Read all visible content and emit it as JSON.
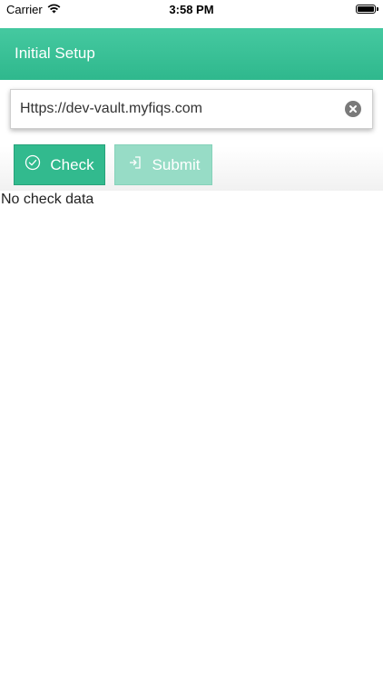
{
  "status_bar": {
    "carrier": "Carrier",
    "time": "3:58 PM",
    "icons": [
      "wifi-icon",
      "battery-icon"
    ]
  },
  "header": {
    "title": "Initial Setup",
    "color": "#3cc197"
  },
  "url_field": {
    "value": "Https://dev-vault.myfiqs.com",
    "clear_icon": "clear-icon"
  },
  "actions": {
    "check_label": "Check",
    "check_icon": "check-circle-icon",
    "submit_label": "Submit",
    "submit_icon": "sign-in-icon",
    "check_color": "#32ba8e",
    "submit_color": "#97dcc6"
  },
  "results": {
    "empty_text": "No check data"
  }
}
